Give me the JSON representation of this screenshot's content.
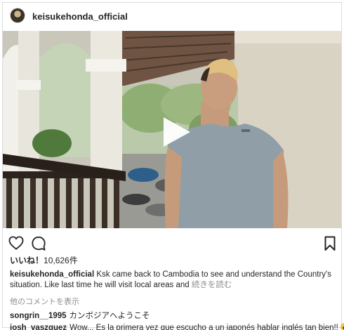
{
  "post": {
    "username": "keisukehonda_official",
    "avatar_icon": "profile-avatar"
  },
  "media": {
    "type": "video",
    "play_icon": "play-icon"
  },
  "actions": {
    "like_icon": "heart-icon",
    "comment_icon": "comment-bubble-icon",
    "save_icon": "bookmark-icon"
  },
  "likes": {
    "label": "いいね！",
    "count": "10,626件"
  },
  "caption": {
    "username": "keisukehonda_official",
    "text": "Ksk came back to Cambodia to see and understand the Country's situation. Like last time he will visit local areas and",
    "more": "続きを読む"
  },
  "view_all_comments": "他のコメントを表示",
  "comments": [
    {
      "username": "songrin__1995",
      "text": "カンボジアへようこそ"
    },
    {
      "username": "josh_vaszquez",
      "text": "Wow... Es la primera vez que escucho a un japonés hablar inglés tan bien!!",
      "emoji": "astonished-face-emoji"
    }
  ],
  "colors": {
    "text": "#262626",
    "muted": "#8e8e8e",
    "border": "#dbdbdb"
  }
}
